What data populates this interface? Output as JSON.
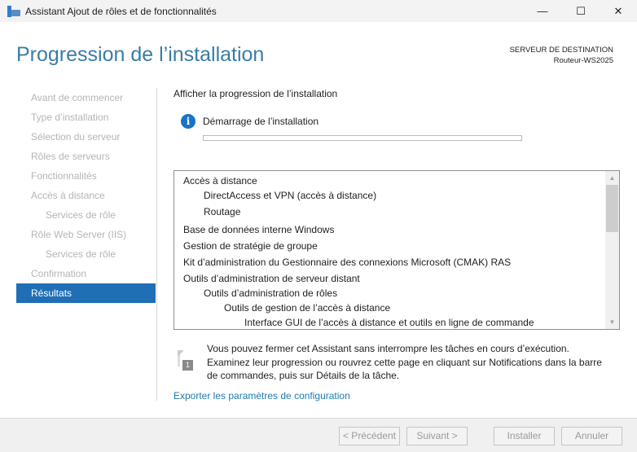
{
  "window": {
    "title": "Assistant Ajout de rôles et de fonctionnalités",
    "minimize": "—",
    "maximize": "☐",
    "close": "✕"
  },
  "header": {
    "title": "Progression de l’installation",
    "dest_label": "SERVEUR DE DESTINATION",
    "dest_server": "Routeur-WS2025"
  },
  "sidebar": {
    "items": [
      {
        "label": "Avant de commencer"
      },
      {
        "label": "Type d’installation"
      },
      {
        "label": "Sélection du serveur"
      },
      {
        "label": "Rôles de serveurs"
      },
      {
        "label": "Fonctionnalités"
      },
      {
        "label": "Accès à distance"
      },
      {
        "label": "Services de rôle"
      },
      {
        "label": "Rôle Web Server (IIS)"
      },
      {
        "label": "Services de rôle"
      },
      {
        "label": "Confirmation"
      },
      {
        "label": "Résultats"
      }
    ],
    "active": "Résultats"
  },
  "main": {
    "section_title": "Afficher la progression de l’installation",
    "status": "Démarrage de l’installation",
    "progress_percent": 0,
    "features": [
      {
        "label": "Accès à distance",
        "level": 0
      },
      {
        "label": "DirectAccess et VPN (accès à distance)",
        "level": 1
      },
      {
        "label": "Routage",
        "level": 1
      },
      {
        "label": "Base de données interne Windows",
        "level": 0
      },
      {
        "label": "Gestion de stratégie de groupe",
        "level": 0
      },
      {
        "label": "Kit d’administration du Gestionnaire des connexions Microsoft (CMAK) RAS",
        "level": 0
      },
      {
        "label": "Outils d’administration de serveur distant",
        "level": 0
      },
      {
        "label": "Outils d’administration de rôles",
        "level": 1
      },
      {
        "label": "Outils de gestion de l’accès à distance",
        "level": 2
      },
      {
        "label": "Interface GUI de l’accès à distance et outils en ligne de commande",
        "level": 3
      }
    ],
    "notice_badge": "1",
    "notice": "Vous pouvez fermer cet Assistant sans interrompre les tâches en cours d’exécution. Examinez leur progression ou rouvrez cette page en cliquant sur Notifications dans la barre de commandes, puis sur Détails de la tâche.",
    "export_link": "Exporter les paramètres de configuration"
  },
  "footer": {
    "previous": "< Précédent",
    "next": "Suivant >",
    "install": "Installer",
    "cancel": "Annuler"
  }
}
